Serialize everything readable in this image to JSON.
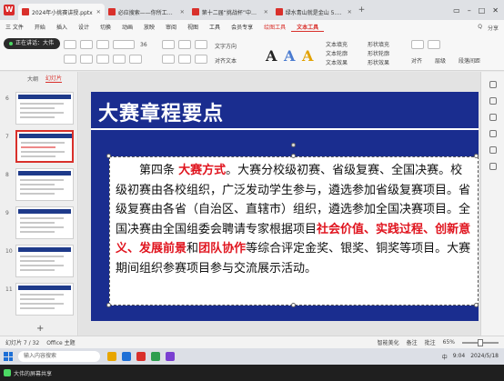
{
  "window": {
    "app_logo": "W",
    "tabs": [
      {
        "label": "2024年小挑赛讲授.pptx",
        "color": "#d9302b",
        "active": true
      },
      {
        "label": "必应搜索——你所工程的独享助力IP",
        "color": "#d9302b",
        "active": false
      },
      {
        "label": "第十二届“挑战杯”中国大学生创业...",
        "color": "#d9302b",
        "active": false
      },
      {
        "label": "绿水青山就是金山 5.17 伍 7.pdf",
        "color": "#d9302b",
        "active": false
      }
    ],
    "controls": [
      "▭",
      "–",
      "□",
      "✕"
    ]
  },
  "menu": {
    "items": [
      "三 文件",
      "开始",
      "插入",
      "设计",
      "切换",
      "动画",
      "放映",
      "审阅",
      "视图",
      "工具",
      "会员专享",
      "绘图工具",
      "文本工具"
    ],
    "active_index": 12,
    "right": [
      "Q",
      "分享"
    ]
  },
  "toolbar": {
    "meeting_status": "正在讲话：大伟",
    "labels": {
      "font_size": "36",
      "text_fill": "文本填充",
      "text_outline": "文本轮廓",
      "text_effect": "文本效果",
      "shape_fill": "形状填充",
      "shape_outline": "形状轮廓",
      "shape_effect": "形状效果",
      "arrange": "对齐",
      "wrap": "层级",
      "text_direction": "文字方向",
      "text_align": "对齐文本",
      "line_spacing": "段落间距"
    }
  },
  "left_panel": {
    "tabs": [
      "大纲",
      "幻灯片"
    ],
    "active_tab": 1,
    "slide_numbers": [
      "6",
      "7",
      "8",
      "9",
      "10",
      "11"
    ],
    "selected_index": 1,
    "add_label": "+"
  },
  "slide": {
    "title": "大赛章程要点",
    "body": {
      "p1": "第四条",
      "highlight1": "大赛方式",
      "p2": "。大赛分校级初赛、省级复赛、全国决赛。校级初赛由各校组织，广泛发动学生参与，遴选参加省级复赛项目。省级复赛由各省（自治区、直辖市）组织，遴选参加全国决赛项目。全国决赛由全国组委会聘请专家根据项目",
      "highlight2": "社会价值",
      "sep1": "、",
      "highlight3": "实践过程",
      "sep2": "、",
      "highlight4": "创新意义",
      "sep3": "、",
      "highlight5": "发展前景",
      "p3": "和",
      "highlight6": "团队协作",
      "p4": "等综合评定金奖、银奖、铜奖等项目。大赛期间组织参赛项目参与交流展示活动。"
    },
    "colors": {
      "header": "#1a2d8f",
      "highlight": "#e0141e"
    }
  },
  "status": {
    "slide_position": "幻灯片 7 / 32",
    "theme": "Office 主题",
    "notes": "备注",
    "comments": "批注",
    "smart_beautify": "智能美化",
    "zoom": "65%",
    "zoom_fraction": 0.5
  },
  "taskbar": {
    "search_placeholder": "输入内容搜索",
    "tray": [
      "中",
      "9:04",
      "2024/5/18"
    ],
    "app_colors": [
      "#e8a500",
      "#1d6fd6",
      "#d9302b",
      "#2e9e4f",
      "#7a3fd1"
    ]
  },
  "meeting": {
    "caption": "大伟的屏幕共享"
  }
}
